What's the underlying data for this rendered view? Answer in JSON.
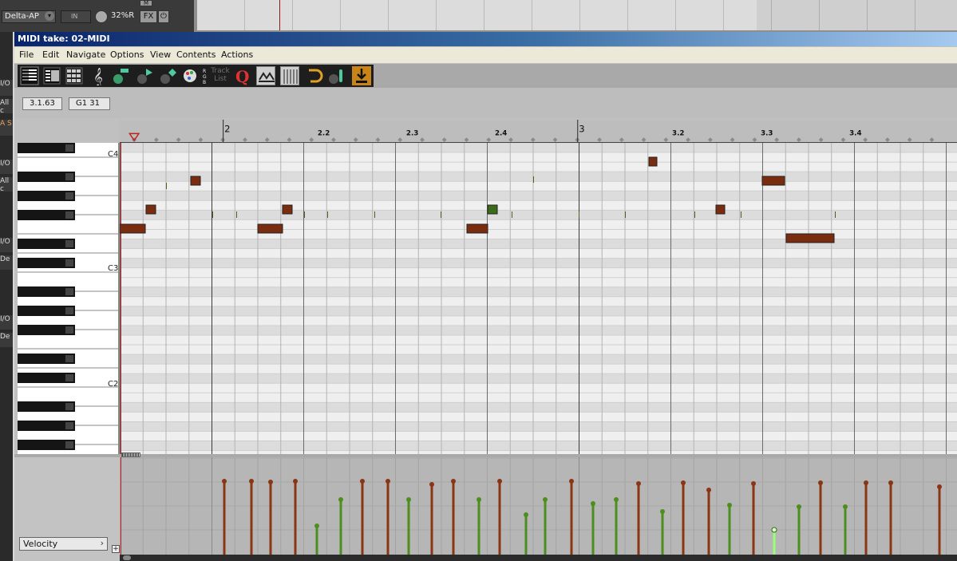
{
  "host": {
    "track_name": "Delta-AP",
    "input_label": "IN",
    "pan": "32%R",
    "fx_label": "FX",
    "mute_label": "M",
    "side_labels": [
      "I/O",
      "All c",
      "A S",
      "I/O",
      "All c",
      "I/O",
      "De",
      "I/O",
      "De"
    ]
  },
  "window": {
    "title": "MIDI take: 02-MIDI"
  },
  "menu": [
    "File",
    "Edit",
    "Navigate",
    "Options",
    "View",
    "Contents",
    "Actions"
  ],
  "toolbar": {
    "icons": [
      "piano-roll-icon",
      "named-notes-icon",
      "drum-grid-icon",
      "notation-icon",
      "insert-note-icon",
      "select-note-icon",
      "erase-note-icon",
      "paint-colors-icon",
      "channel-colors-icon"
    ],
    "track_list_label": "Track List",
    "right_icons": [
      "quantize-icon",
      "snap-icon",
      "grid-icon",
      "loop-icon",
      "step-input-icon",
      "midi-input-icon"
    ]
  },
  "info": {
    "position": "3.1.63",
    "pitch": "G1  31"
  },
  "keyboard": {
    "labels": [
      {
        "text": "C4"
      },
      {
        "text": "C3"
      },
      {
        "text": "C2"
      }
    ]
  },
  "ruler": {
    "labels": [
      "2",
      "2.2",
      "2.3",
      "2.4",
      "3",
      "3.2",
      "3.3",
      "3.4"
    ]
  },
  "velocity_lane": {
    "selected": "Velocity"
  },
  "colors": {
    "note_brown": "#7a2c0f",
    "note_green": "#3c6b1a",
    "stem_brown": "#8a3514",
    "stem_green": "#4d8f1f",
    "stem_selected": "#9cff7a"
  }
}
